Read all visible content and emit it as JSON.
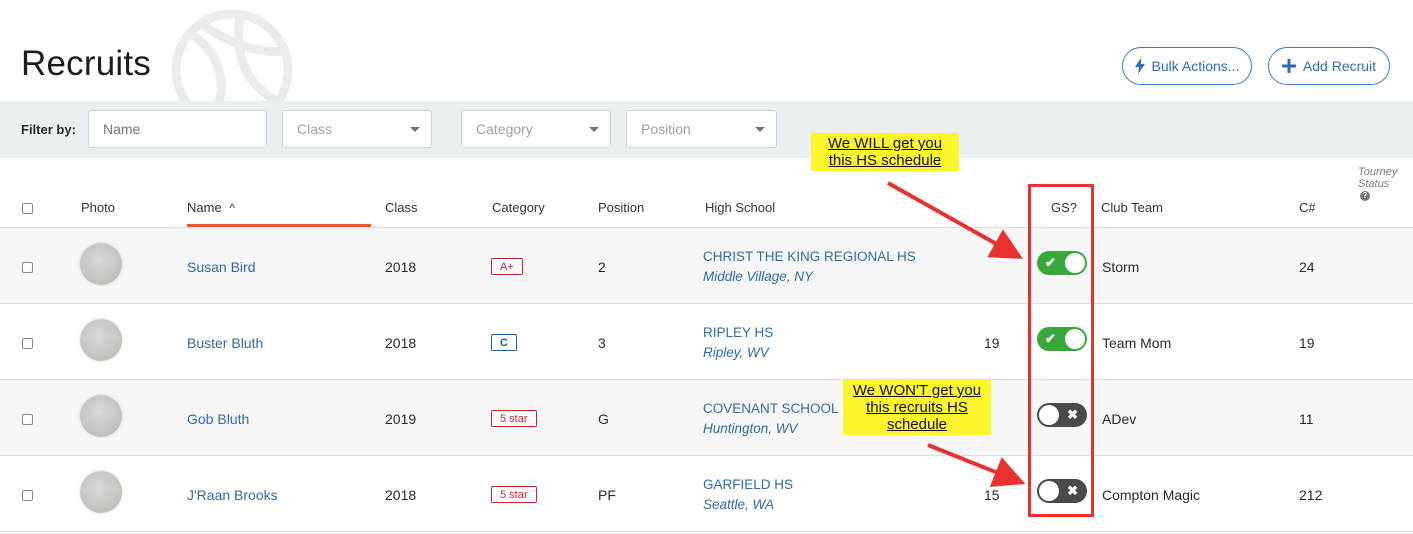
{
  "page": {
    "title": "Recruits"
  },
  "actions": {
    "bulk_label": "Bulk Actions...",
    "add_label": "Add Recruit"
  },
  "filters": {
    "label": "Filter by:",
    "name_placeholder": "Name",
    "class_placeholder": "Class",
    "category_placeholder": "Category",
    "position_placeholder": "Position"
  },
  "table": {
    "headers": {
      "photo": "Photo",
      "name": "Name",
      "sort_indicator": "^",
      "class": "Class",
      "category": "Category",
      "position": "Position",
      "high_school": "High School",
      "gs": "GS?",
      "club_team": "Club Team",
      "c_number": "C#",
      "tourney_status_line1": "Tourney",
      "tourney_status_line2": "Status",
      "help_glyph": "?"
    },
    "rows": [
      {
        "name": "Susan Bird",
        "class": "2018",
        "category": "A+",
        "position": "2",
        "hs_name": "CHRIST THE KING REGIONAL HS",
        "hs_location": "Middle Village, NY",
        "number": "",
        "gs": true,
        "club_team": "Storm",
        "c_number": "24"
      },
      {
        "name": "Buster Bluth",
        "class": "2018",
        "category": "C",
        "position": "3",
        "hs_name": "RIPLEY HS",
        "hs_location": "Ripley, WV",
        "number": "19",
        "gs": true,
        "club_team": "Team Mom",
        "c_number": "19"
      },
      {
        "name": "Gob Bluth",
        "class": "2019",
        "category": "5 star",
        "position": "G",
        "hs_name": "COVENANT SCHOOL",
        "hs_location": "Huntington, WV",
        "number": "",
        "gs": false,
        "club_team": "ADev",
        "c_number": "11"
      },
      {
        "name": "J'Raan Brooks",
        "class": "2018",
        "category": "5 star",
        "position": "PF",
        "hs_name": "GARFIELD HS",
        "hs_location": "Seattle, WA",
        "number": "15",
        "gs": false,
        "club_team": "Compton Magic",
        "c_number": "212"
      }
    ]
  },
  "toggle_glyphs": {
    "on": "✔",
    "off": "✖"
  },
  "annotations": {
    "will_line1": "We WILL get you",
    "will_line2": "this HS schedule",
    "wont_line1": "We WON'T get you",
    "wont_line2": "this recruits HS",
    "wont_line3": "schedule"
  },
  "colors": {
    "accent": "#2d6db5",
    "sort_underline": "#e15d29",
    "toggle_on": "#3aa73a",
    "toggle_off": "#4a4a4a",
    "annotation_red": "#e8322f",
    "annotation_yellow": "#fdf62d"
  }
}
